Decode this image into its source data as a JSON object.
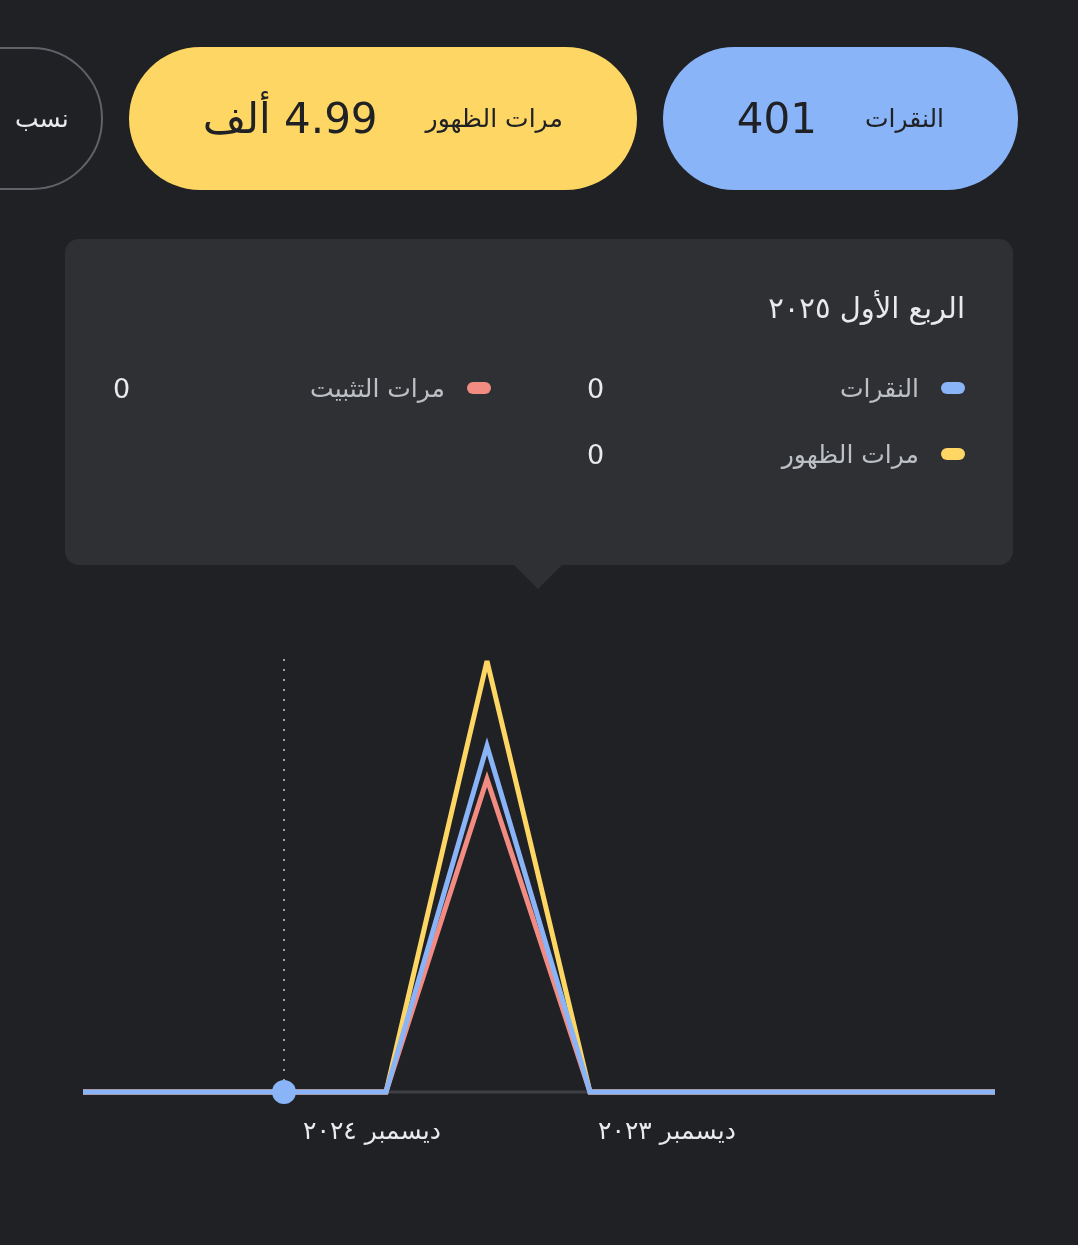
{
  "metric_chips": [
    {
      "label": "النقرات",
      "value": "401",
      "selected": true,
      "color": "#8ab4f8"
    },
    {
      "label": "مرات الظهور",
      "value": "4.99 ألف",
      "selected": true,
      "color": "#fdd663"
    },
    {
      "label": "نسب",
      "selected": false
    }
  ],
  "tooltip": {
    "title": "الربع الأول ٢٠٢٥",
    "series": [
      {
        "name": "النقرات",
        "value": "0",
        "color": "#8ab4f8"
      },
      {
        "name": "مرات الظهور",
        "value": "0",
        "color": "#fdd663"
      },
      {
        "name": "مرات التثبيت",
        "value": "0",
        "color": "#f28b82"
      }
    ]
  },
  "chart": {
    "x_labels": [
      "ديسمبر ٢٠٢٣",
      "ديسمبر ٢٠٢٤"
    ]
  }
}
